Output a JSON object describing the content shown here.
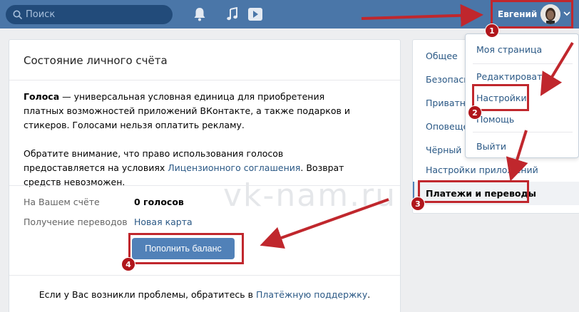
{
  "header": {
    "search_placeholder": "Поиск",
    "user_name": "Евгений",
    "icons": [
      "search-icon",
      "bell-icon",
      "music-note-icon",
      "play-video-icon",
      "chevron-down-icon"
    ]
  },
  "main": {
    "title": "Состояние личного счёта",
    "info_term": "Голоса",
    "info_text_1": " — универсальная условная единица для приобретения платных возможностей приложений ВКонтакте, а также подарков и стикеров. Голосами нельзя оплатить рекламу.",
    "info_text_2_a": "Обратите внимание, что право использования голосов предоставляется на условиях ",
    "info_link": "Лицензионного соглашения",
    "info_text_2_b": ". Возврат средств невозможен.",
    "balance_label": "На Вашем счёте",
    "balance_value": "0 голосов",
    "transfers_label": "Получение переводов",
    "transfers_value": "Новая карта",
    "topup_button": "Пополнить баланс",
    "footer_text": "Если у Вас возникли проблемы, обратитесь в ",
    "footer_link": "Платёжную поддержку",
    "footer_end": ".",
    "watermark": "vk-nam.ru"
  },
  "side_menu": {
    "items": [
      {
        "label": "Общее"
      },
      {
        "label": "Безопасность"
      },
      {
        "label": "Приватность"
      },
      {
        "label": "Оповещения"
      },
      {
        "label": "Чёрный список"
      },
      {
        "label": "Настройки приложений"
      },
      {
        "label": "Платежи и переводы"
      }
    ]
  },
  "dropdown": {
    "items": [
      {
        "label": "Моя страница"
      },
      {
        "label": "Редактировать"
      },
      {
        "label": "Настройки"
      },
      {
        "label": "Помощь"
      },
      {
        "label": "Выйти"
      }
    ]
  },
  "annotations": {
    "steps": [
      "1",
      "2",
      "3",
      "4"
    ],
    "color": "#c0272d"
  }
}
